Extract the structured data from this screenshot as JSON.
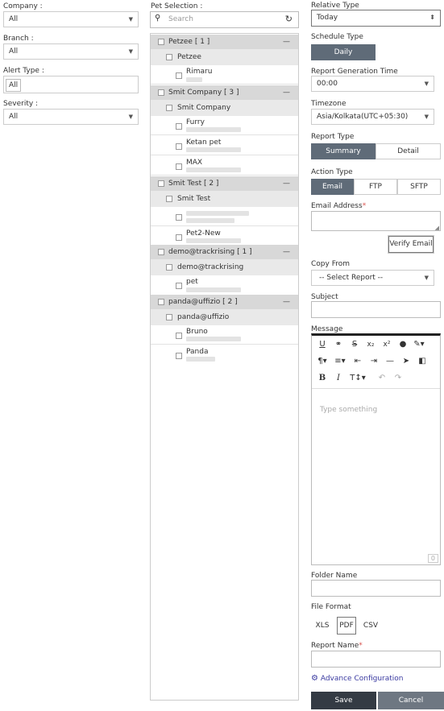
{
  "left": {
    "company_label": "Company :",
    "company_value": "All",
    "branch_label": "Branch :",
    "branch_value": "All",
    "alert_type_label": "Alert Type :",
    "alert_type_value": "All",
    "severity_label": "Severity :",
    "severity_value": "All"
  },
  "pets": {
    "label": "Pet Selection :",
    "search_placeholder": "Search",
    "groups": [
      {
        "name": "Petzee [ 1 ]",
        "sub": "Petzee",
        "items": [
          "Rimaru"
        ]
      },
      {
        "name": "Smit Company [ 3 ]",
        "sub": "Smit Company",
        "items": [
          "Furry",
          "Ketan pet",
          "MAX"
        ]
      },
      {
        "name": "Smit Test [ 2 ]",
        "sub": "Smit Test",
        "items": [
          "",
          "Pet2-New"
        ]
      },
      {
        "name": "demo@trackrising [ 1 ]",
        "sub": "demo@trackrising",
        "items": [
          "pet"
        ]
      },
      {
        "name": "panda@uffizio [ 2 ]",
        "sub": "panda@uffizio",
        "items": [
          "Bruno",
          "Panda"
        ]
      }
    ]
  },
  "right": {
    "relative_type_label": "Relative Type",
    "relative_type_value": "Today",
    "schedule_type_label": "Schedule Type",
    "schedule_daily": "Daily",
    "gen_time_label": "Report Generation Time",
    "gen_time_value": "00:00",
    "timezone_label": "Timezone",
    "timezone_value": "Asia/Kolkata(UTC+05:30)",
    "report_type_label": "Report Type",
    "report_summary": "Summary",
    "report_detail": "Detail",
    "action_type_label": "Action Type",
    "action_email": "Email",
    "action_ftp": "FTP",
    "action_sftp": "SFTP",
    "email_label": "Email Address",
    "required_mark": "*",
    "verify_email": "Verify Email",
    "copy_from_label": "Copy From",
    "copy_from_value": "-- Select Report --",
    "subject_label": "Subject",
    "message_label": "Message",
    "message_placeholder": "Type something",
    "char_count": "0",
    "folder_name_label": "Folder Name",
    "file_format_label": "File Format",
    "fmt_xls": "XLS",
    "fmt_pdf": "PDF",
    "fmt_csv": "CSV",
    "report_name_label": "Report Name",
    "advance_config": "Advance Configuration",
    "save": "Save",
    "cancel": "Cancel"
  },
  "colors": {
    "dark_button": "#5f6b78",
    "save_bg": "#343b44",
    "cancel_bg": "#6e7782",
    "link": "#3a3aa0",
    "required": "#d9534f"
  }
}
